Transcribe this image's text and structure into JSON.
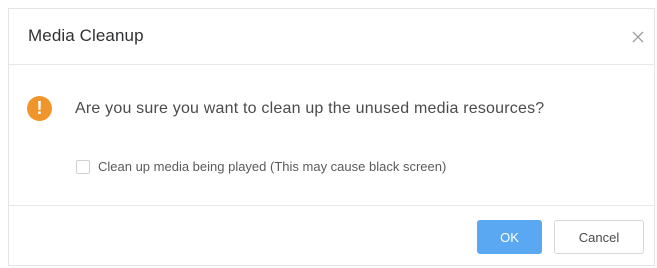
{
  "dialog": {
    "title": "Media Cleanup",
    "close_icon": "close-icon",
    "message": "Are you sure you want to clean up the unused media resources?",
    "warning_icon": "exclamation-icon",
    "warning_color": "#f0952b",
    "warning_glyph": "!",
    "option": {
      "label": "Clean up media being played (This may cause black screen)",
      "checked": false
    },
    "buttons": {
      "ok_label": "OK",
      "cancel_label": "Cancel"
    },
    "accent_color": "#5aa7f2"
  }
}
